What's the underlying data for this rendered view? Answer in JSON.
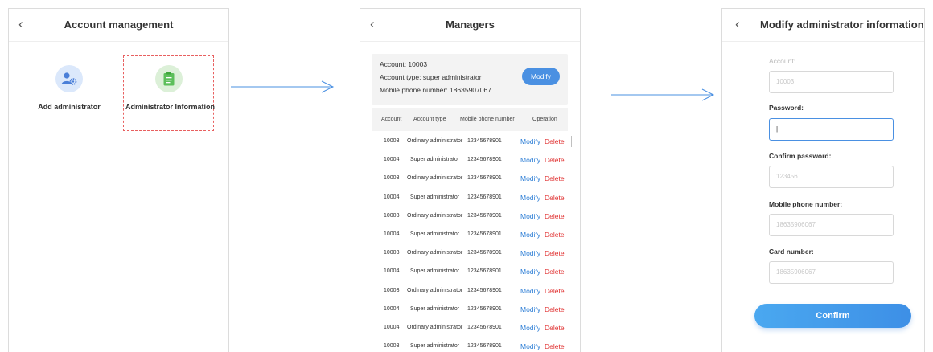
{
  "screen1": {
    "title": "Account management",
    "tiles": [
      {
        "label": "Add administrator",
        "icon": "user-gear-icon"
      },
      {
        "label": "Administrator Information",
        "icon": "document-icon"
      }
    ]
  },
  "screen2": {
    "title": "Managers",
    "info": {
      "account": "Account: 10003",
      "type": "Account type: super administrator",
      "phone": "Mobile phone number: 18635907067",
      "modify_label": "Modify"
    },
    "columns": [
      "Account",
      "Account type",
      "Mobile phone number",
      "Operation"
    ],
    "rows": [
      {
        "account": "10003",
        "type": "Ordinary administrator",
        "phone": "12345678901",
        "modify": "Modify",
        "delete": "Delete"
      },
      {
        "account": "10004",
        "type": "Super administrator",
        "phone": "12345678901",
        "modify": "Modify",
        "delete": "Delete"
      },
      {
        "account": "10003",
        "type": "Ordinary administrator",
        "phone": "12345678901",
        "modify": "Modify",
        "delete": "Delete"
      },
      {
        "account": "10004",
        "type": "Super administrator",
        "phone": "12345678901",
        "modify": "Modify",
        "delete": "Delete"
      },
      {
        "account": "10003",
        "type": "Ordinary administrator",
        "phone": "12345678901",
        "modify": "Modify",
        "delete": "Delete"
      },
      {
        "account": "10004",
        "type": "Super administrator",
        "phone": "12345678901",
        "modify": "Modify",
        "delete": "Delete"
      },
      {
        "account": "10003",
        "type": "Ordinary administrator",
        "phone": "12345678901",
        "modify": "Modify",
        "delete": "Delete"
      },
      {
        "account": "10004",
        "type": "Super administrator",
        "phone": "12345678901",
        "modify": "Modify",
        "delete": "Delete"
      },
      {
        "account": "10003",
        "type": "Ordinary administrator",
        "phone": "12345678901",
        "modify": "Modify",
        "delete": "Delete"
      },
      {
        "account": "10004",
        "type": "Super administrator",
        "phone": "12345678901",
        "modify": "Modify",
        "delete": "Delete"
      },
      {
        "account": "10004",
        "type": "Ordinary administrator",
        "phone": "12345678901",
        "modify": "Modify",
        "delete": "Delete"
      },
      {
        "account": "10003",
        "type": "Super administrator",
        "phone": "12345678901",
        "modify": "Modify",
        "delete": "Delete"
      }
    ]
  },
  "screen3": {
    "title": "Modify administrator information",
    "fields": {
      "account": {
        "label": "Account:",
        "value": "10003"
      },
      "password": {
        "label": "Password:",
        "value": "|"
      },
      "confirm_password": {
        "label": "Confirm password:",
        "value": "123456"
      },
      "mobile": {
        "label": "Mobile phone number:",
        "value": "18635906067"
      },
      "card": {
        "label": "Card number:",
        "value": "18635906067"
      }
    },
    "confirm_label": "Confirm"
  },
  "colors": {
    "accent": "#4a90e2",
    "delete": "#e03030",
    "highlight_dash": "#e86060"
  }
}
